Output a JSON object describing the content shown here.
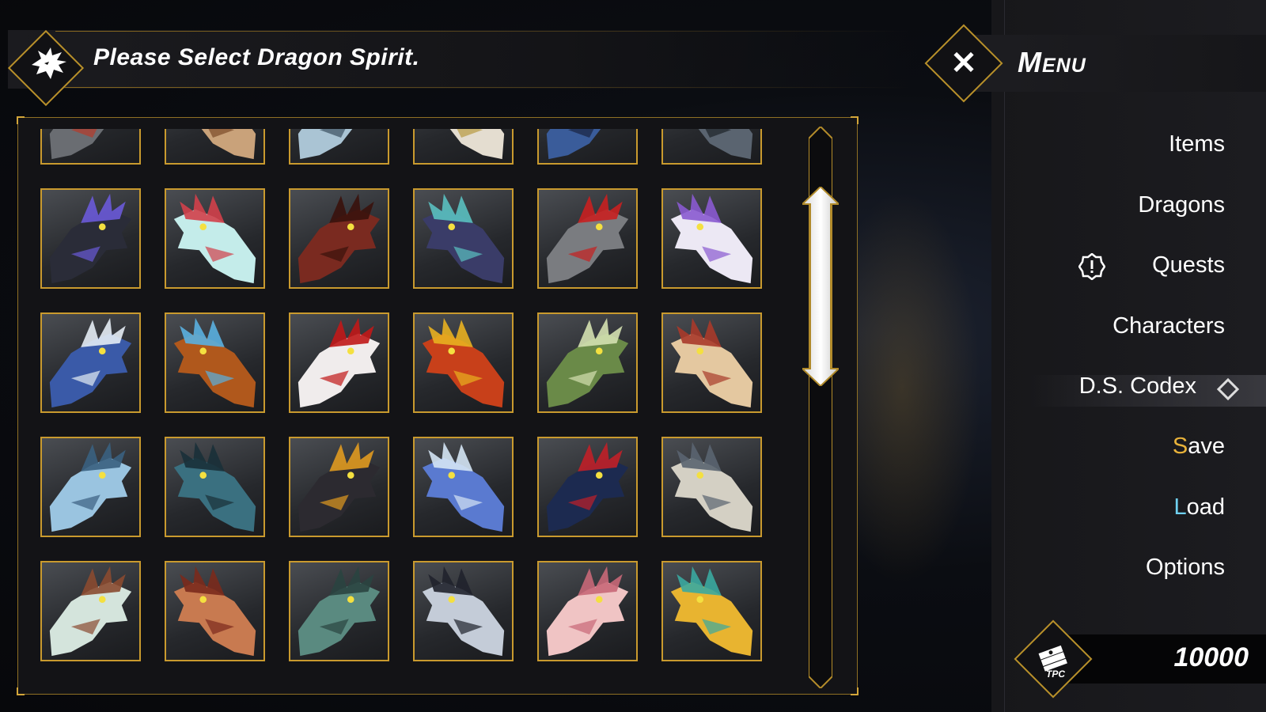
{
  "header": {
    "title": "Please Select Dragon Spirit.",
    "logo_icon": "dragon-head-icon"
  },
  "menu": {
    "title": "Menu",
    "close_icon": "close-icon",
    "items": [
      {
        "label": "Items"
      },
      {
        "label": "Dragons"
      },
      {
        "label": "Quests",
        "icon": "alert-icon"
      },
      {
        "label": "Characters"
      },
      {
        "label": "D.S. Codex",
        "selected": true
      },
      {
        "label": "Save",
        "first": "S",
        "rest": "ave",
        "accent": "#e8b23a"
      },
      {
        "label": "Load",
        "first": "L",
        "rest": "oad",
        "accent": "#6fd0f0"
      },
      {
        "label": "Options"
      }
    ]
  },
  "currency": {
    "value": "10000",
    "icon": "tpc-money-icon",
    "icon_label": "TPC"
  },
  "grid": {
    "columns": 6,
    "tiles": [
      {
        "name": "red-striped-dragon",
        "c1": "#6a6d72",
        "c2": "#b83a2a"
      },
      {
        "name": "tan-horned-dragon",
        "c1": "#c9a27a",
        "c2": "#7a4a28"
      },
      {
        "name": "pale-blue-dragon",
        "c1": "#aac4d4",
        "c2": "#3a5060"
      },
      {
        "name": "white-gold-dragon",
        "c1": "#e4ddd0",
        "c2": "#b89a40"
      },
      {
        "name": "navy-dragon",
        "c1": "#3a5c9a",
        "c2": "#1a2440"
      },
      {
        "name": "steel-grey-dragon",
        "c1": "#5a6470",
        "c2": "#1c2228"
      },
      {
        "name": "violet-shadow-dragon",
        "c1": "#2a2c38",
        "c2": "#6a5ad8"
      },
      {
        "name": "aqua-spotted-dragon",
        "c1": "#c4ecea",
        "c2": "#d2404a"
      },
      {
        "name": "crimson-spiked-dragon",
        "c1": "#7a2a20",
        "c2": "#3a120c"
      },
      {
        "name": "raven-dragon",
        "c1": "#3a3c68",
        "c2": "#5ac0c0"
      },
      {
        "name": "silver-fanged-dragon",
        "c1": "#7a7c80",
        "c2": "#c82020"
      },
      {
        "name": "white-purple-horned-dragon",
        "c1": "#ece8f4",
        "c2": "#8a5ad0"
      },
      {
        "name": "azure-mask-dragon",
        "c1": "#3a5aa8",
        "c2": "#e4ecf4"
      },
      {
        "name": "orange-blue-eye-dragon",
        "c1": "#b0581c",
        "c2": "#5ab0e0"
      },
      {
        "name": "white-red-crest-dragon",
        "c1": "#f0ecec",
        "c2": "#c01818"
      },
      {
        "name": "magma-dragon",
        "c1": "#c8401a",
        "c2": "#e8b020"
      },
      {
        "name": "moss-green-dragon",
        "c1": "#6a8a48",
        "c2": "#d4e0b0"
      },
      {
        "name": "bone-beak-dragon",
        "c1": "#e4c8a0",
        "c2": "#a83a2a"
      },
      {
        "name": "frost-blue-dragon",
        "c1": "#9ac4e0",
        "c2": "#3a6080"
      },
      {
        "name": "teal-armored-dragon",
        "c1": "#3a7080",
        "c2": "#1a3038"
      },
      {
        "name": "obsidian-gold-dragon",
        "c1": "#2c2a30",
        "c2": "#e09a20"
      },
      {
        "name": "crystal-blue-dragon",
        "c1": "#5a7ad0",
        "c2": "#d4e4f4"
      },
      {
        "name": "red-green-fin-dragon",
        "c1": "#1c2a50",
        "c2": "#c02028"
      },
      {
        "name": "ivory-horn-dragon",
        "c1": "#d4d0c4",
        "c2": "#5a6470"
      },
      {
        "name": "antler-white-dragon",
        "c1": "#d4e4dc",
        "c2": "#8a4a30"
      },
      {
        "name": "rust-maw-dragon",
        "c1": "#c87a50",
        "c2": "#7a2a1c"
      },
      {
        "name": "jade-whisker-dragon",
        "c1": "#5a8a80",
        "c2": "#2a4440"
      },
      {
        "name": "ink-curl-dragon",
        "c1": "#c4ccd8",
        "c2": "#20222c"
      },
      {
        "name": "pink-fluff-dragon",
        "c1": "#f0c4c4",
        "c2": "#c86878"
      },
      {
        "name": "golden-flame-dragon",
        "c1": "#e8b430",
        "c2": "#3aa8a0"
      }
    ]
  }
}
